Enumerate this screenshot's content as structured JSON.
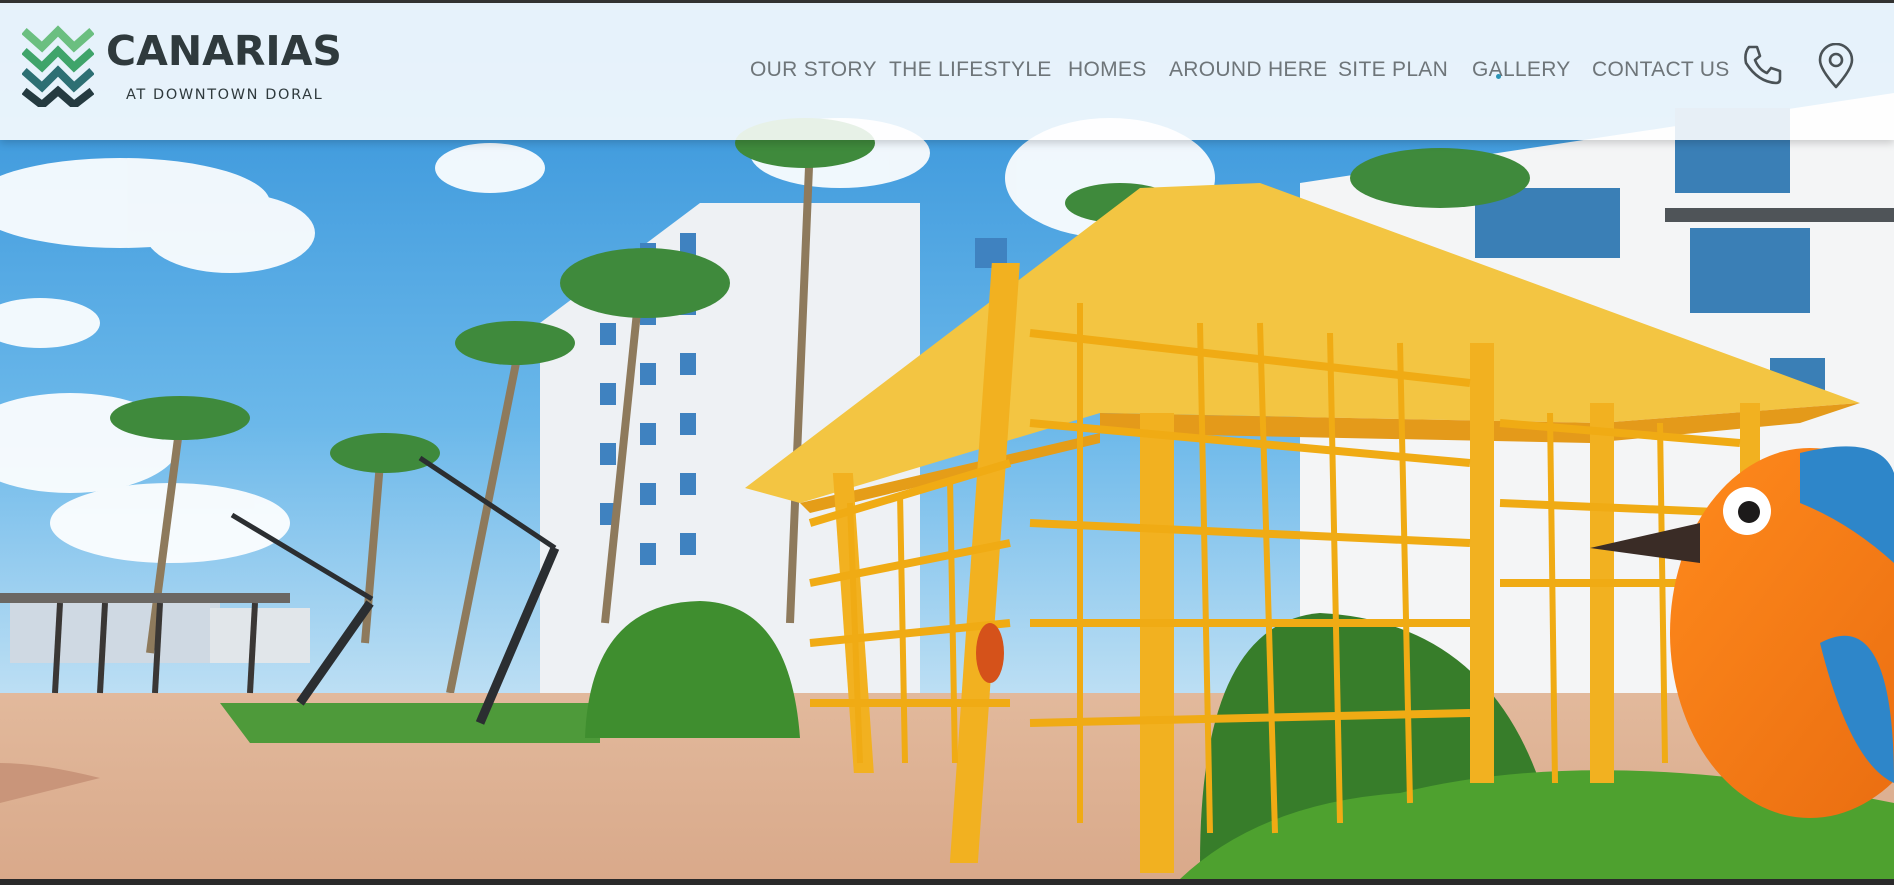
{
  "brand": {
    "name": "CANARIAS",
    "tagline": "AT DOWNTOWN DORAL",
    "logo_icon": "canarias-chevron-logo"
  },
  "nav": {
    "items": [
      {
        "label": "OUR STORY"
      },
      {
        "label": "THE LIFESTYLE"
      },
      {
        "label": "HOMES"
      },
      {
        "label": "AROUND HERE"
      },
      {
        "label": "SITE PLAN"
      },
      {
        "label": "GALLERY"
      },
      {
        "label": "CONTACT US"
      }
    ],
    "icons": [
      "phone-icon",
      "location-pin-icon"
    ]
  },
  "hero": {
    "image": "hero-photo-yellow-pergola-palms-apartments-bird-sculpture"
  },
  "colors": {
    "logo_green": "#3fa46a",
    "logo_teal": "#2d6f73",
    "logo_dark": "#253a40",
    "nav_text": "#6e7579",
    "pergola_yellow": "#f2b120",
    "sky_blue": "#3f9fe0"
  }
}
